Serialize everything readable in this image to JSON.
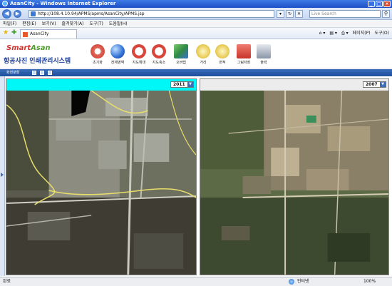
{
  "window": {
    "title": "AsanCity - Windows Internet Explorer"
  },
  "browser": {
    "address": "http://108.4.10.94/APMS/apms/AsanCity/APMS.jsp",
    "search_placeholder": "Live Search",
    "menu": [
      "파일(F)",
      "편집(E)",
      "보기(V)",
      "즐겨찾기(A)",
      "도구(T)",
      "도움말(H)"
    ],
    "tab_title": "AsanCity",
    "commands": {
      "page": "페이지(P)",
      "tools": "도구(O)"
    }
  },
  "app": {
    "brand_part1": "Smart",
    "brand_part2": "Asan",
    "title": "항공사진 인쇄관리시스템",
    "tools": [
      {
        "label": "초기화",
        "icon": "reset-icon",
        "color": "#d8453b"
      },
      {
        "label": "전체영역",
        "icon": "globe-icon",
        "color": "#2f6fd6"
      },
      {
        "label": "지도확대",
        "icon": "zoom-in-icon",
        "color": "#d8453b"
      },
      {
        "label": "지도축소",
        "icon": "zoom-out-icon",
        "color": "#d8453b"
      },
      {
        "label": "오버랩",
        "icon": "overlap-icon",
        "color": "#3c9a4a"
      },
      {
        "label": "거리",
        "icon": "distance-icon",
        "color": "#d9b21a"
      },
      {
        "label": "면적",
        "icon": "area-icon",
        "color": "#d9b21a"
      },
      {
        "label": "그림저장",
        "icon": "save-image-icon",
        "color": "#d8453b"
      },
      {
        "label": "출력",
        "icon": "printer-icon",
        "color": "#6b7a8c"
      }
    ],
    "map_toolbar": {
      "split_label": "화면분할"
    },
    "left_pane": {
      "year": "2011"
    },
    "right_pane": {
      "year": "2007"
    }
  },
  "status": {
    "left": "완료",
    "zone": "인터넷",
    "zoom": "100%"
  }
}
